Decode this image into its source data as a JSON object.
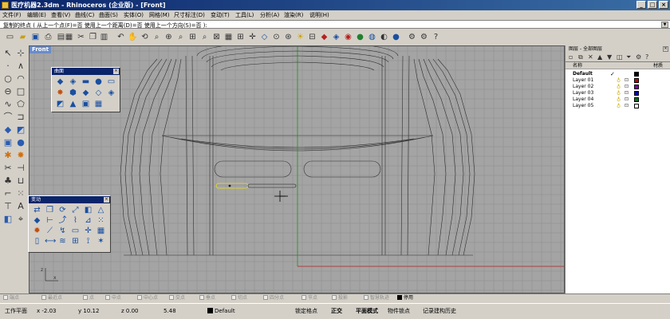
{
  "window": {
    "title": "医疗机器2.3dm - Rhinoceros (企业版) - [Front]",
    "controls": [
      "_",
      "□",
      "×"
    ]
  },
  "menu": [
    "文件(F)",
    "编辑(E)",
    "查看(V)",
    "曲线(C)",
    "曲面(S)",
    "实体(O)",
    "网格(M)",
    "尺寸标注(D)",
    "变动(T)",
    "工具(L)",
    "分析(A)",
    "渲染(R)",
    "说明(H)"
  ],
  "command": {
    "prompt": "复制的终点 ( 从上一个点(F)=否  使用上一个距离(D)=否  使用上一个方向(S)=否 ):"
  },
  "viewport": {
    "label": "Front",
    "colors": {
      "background": "#a4a4a4",
      "wire": "#303030",
      "grid": "#8a8a8a",
      "x_axis": "#b02020",
      "y_axis": "#209020",
      "selected": "#e8e020"
    }
  },
  "palettes": {
    "surface": {
      "title": "曲面",
      "close": "×"
    },
    "transform": {
      "title": "变动",
      "close": "×"
    }
  },
  "layers": {
    "title": "图层 - 全部图层",
    "close": "×",
    "col_name": "名称",
    "col_material": "材质",
    "items": [
      {
        "name": "Default",
        "color": "#000000",
        "current": true,
        "check": "✓"
      },
      {
        "name": "Layer 01",
        "color": "#c00000"
      },
      {
        "name": "Layer 02",
        "color": "#8000a0"
      },
      {
        "name": "Layer 03",
        "color": "#0000c0"
      },
      {
        "name": "Layer 04",
        "color": "#007020"
      },
      {
        "name": "Layer 05",
        "color": "#ffffff"
      }
    ]
  },
  "osnaps": [
    {
      "label": "端点",
      "on": false
    },
    {
      "label": "最近点",
      "on": false
    },
    {
      "label": "点",
      "on": false
    },
    {
      "label": "中点",
      "on": false
    },
    {
      "label": "中心点",
      "on": false
    },
    {
      "label": "交点",
      "on": false
    },
    {
      "label": "垂点",
      "on": false
    },
    {
      "label": "切点",
      "on": false
    },
    {
      "label": "四分点",
      "on": false
    },
    {
      "label": "节点",
      "on": false
    },
    {
      "label": "投影",
      "on": false
    },
    {
      "label": "智慧轨迹",
      "on": false
    },
    {
      "label": "停用",
      "on": true
    }
  ],
  "status": {
    "cplane": "工作平面",
    "x": "x -2.03",
    "y": "y 10.12",
    "z": "z 0.00",
    "dist": "5.48",
    "layer": "Default",
    "grid_snap": "锁定格点",
    "ortho": "正交",
    "planar": "平面模式",
    "osnap": "物件锁点",
    "history": "记录建构历史"
  }
}
